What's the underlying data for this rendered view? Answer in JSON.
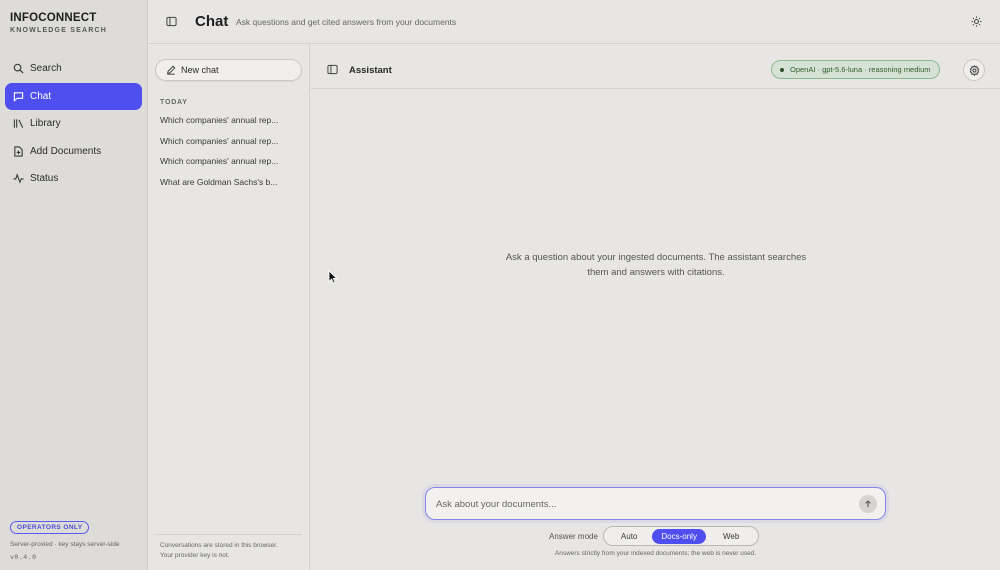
{
  "sidebar": {
    "brand_name": "INFOCONNECT",
    "brand_sub": "KNOWLEDGE SEARCH",
    "items": [
      {
        "label": "Search",
        "icon": "search-icon",
        "active": false
      },
      {
        "label": "Chat",
        "icon": "chat-icon",
        "active": true
      },
      {
        "label": "Library",
        "icon": "library-icon",
        "active": false
      },
      {
        "label": "Add Documents",
        "icon": "add-document-icon",
        "active": false
      },
      {
        "label": "Status",
        "icon": "activity-icon",
        "active": false
      }
    ],
    "badge": "OPERATORS ONLY",
    "footer_note": "Server-proxied · key stays server-side",
    "version": "v0.4.0"
  },
  "header": {
    "title": "Chat",
    "subtitle": "Ask questions and get cited answers from your documents"
  },
  "conversations": {
    "new_chat_label": "New chat",
    "group_label": "TODAY",
    "items": [
      "Which companies' annual rep...",
      "Which companies' annual rep...",
      "Which companies' annual rep...",
      "What are Goldman Sachs's b..."
    ],
    "footer_line1": "Conversations are stored in this browser.",
    "footer_line2": "Your provider key is not."
  },
  "assistant": {
    "title": "Assistant",
    "model_pill": "OpenAI · gpt-5.6-luna · reasoning medium",
    "empty_line1": "Ask a question about your ingested documents. The assistant searches",
    "empty_line2": "them and answers with citations.",
    "input_placeholder": "Ask about your documents...",
    "mode_label": "Answer mode",
    "modes": [
      "Auto",
      "Docs-only",
      "Web"
    ],
    "active_mode": "Docs-only",
    "mode_hint": "Answers strictly from your indexed documents; the web is never used."
  },
  "colors": {
    "accent": "#4f4ff0",
    "sidebar_bg": "#dddcd9",
    "page_bg": "#e7e6e4",
    "model_pill_bg": "#d6e3d4",
    "model_pill_border": "#8db98f"
  }
}
